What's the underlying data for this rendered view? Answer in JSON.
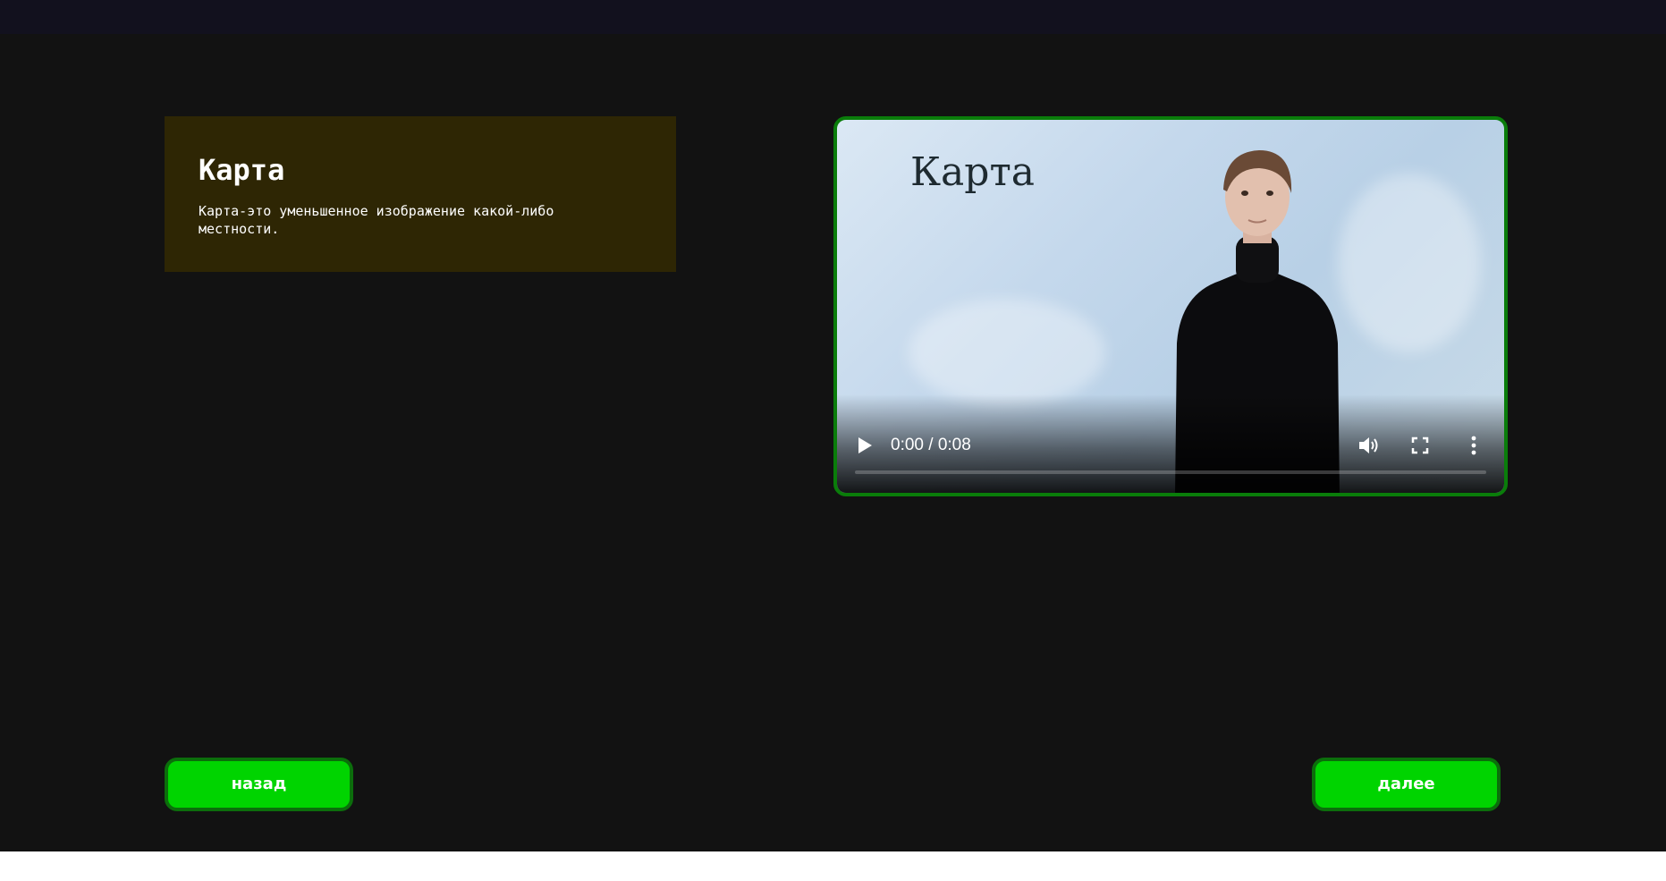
{
  "card": {
    "title": "Карта",
    "text": "Карта-это уменьшенное изображение какой-либо местности."
  },
  "video": {
    "title_overlay": "Карта",
    "time": "0:00 / 0:08",
    "progress": 0,
    "icons": [
      "play-icon",
      "volume-icon",
      "fullscreen-icon",
      "more-options-icon"
    ]
  },
  "nav": {
    "back_label": "назад",
    "next_label": "далее"
  },
  "colors": {
    "page_bg": "#121212",
    "top_bar": "#12111e",
    "card_bg": "#2e2604",
    "button_bg": "#00d400",
    "button_border": "#0b6e0b",
    "video_border": "#0a7d0a"
  }
}
